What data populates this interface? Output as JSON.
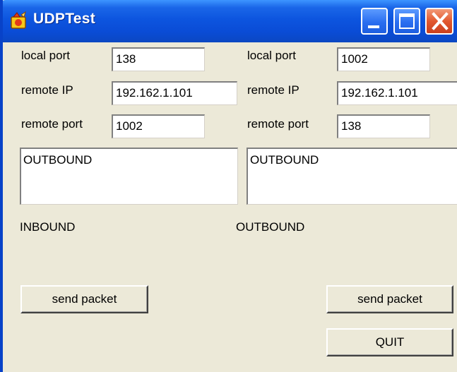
{
  "window": {
    "title": "UDPTest",
    "icon": "udp-app-icon",
    "controls": [
      "minimize-icon",
      "maximize-icon",
      "close-icon"
    ]
  },
  "left": {
    "local_port_label": "local port",
    "local_port_value": "138",
    "remote_ip_label": "remote IP",
    "remote_ip_value": "192.162.1.101",
    "remote_port_label": "remote port",
    "remote_port_value": "1002",
    "outbound_text": "OUTBOUND",
    "inbound_label": "INBOUND",
    "send_button": "send packet"
  },
  "right": {
    "local_port_label": "local port",
    "local_port_value": "1002",
    "remote_ip_label": "remote IP",
    "remote_ip_value": "192.162.1.101",
    "remote_port_label": "remote port",
    "remote_port_value": "138",
    "outbound_text": "OUTBOUND",
    "outbound_label": "OUTBOUND",
    "send_button": "send packet",
    "quit_button": "QUIT"
  },
  "colors": {
    "titlebar": "#0A4CD6",
    "face": "#ECE9D8",
    "close": "#E2582F"
  }
}
